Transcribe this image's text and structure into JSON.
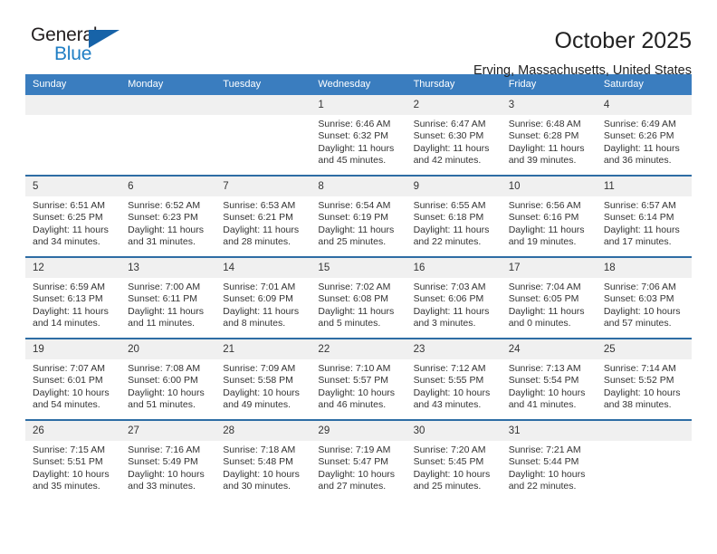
{
  "logo": {
    "word_one": "General",
    "word_two": "Blue",
    "triangle_color": "#1763a8",
    "blue_text_color": "#1f7ec4"
  },
  "header": {
    "title": "October 2025",
    "subtitle": "Erving, Massachusetts, United States"
  },
  "theme": {
    "header_row_background": "#3a7dbf",
    "week_separator": "#2e6da4",
    "date_band_background": "#f0f0f0",
    "text_color": "#333333"
  },
  "calendar": {
    "day_names": [
      "Sunday",
      "Monday",
      "Tuesday",
      "Wednesday",
      "Thursday",
      "Friday",
      "Saturday"
    ],
    "labels": {
      "sunrise": "Sunrise:",
      "sunset": "Sunset:",
      "daylight": "Daylight:"
    },
    "weeks": [
      {
        "days": [
          {
            "date": "",
            "empty": true
          },
          {
            "date": "",
            "empty": true
          },
          {
            "date": "",
            "empty": true
          },
          {
            "date": "1",
            "sunrise": "Sunrise: 6:46 AM",
            "sunset": "Sunset: 6:32 PM",
            "daylight": "Daylight: 11 hours and 45 minutes."
          },
          {
            "date": "2",
            "sunrise": "Sunrise: 6:47 AM",
            "sunset": "Sunset: 6:30 PM",
            "daylight": "Daylight: 11 hours and 42 minutes."
          },
          {
            "date": "3",
            "sunrise": "Sunrise: 6:48 AM",
            "sunset": "Sunset: 6:28 PM",
            "daylight": "Daylight: 11 hours and 39 minutes."
          },
          {
            "date": "4",
            "sunrise": "Sunrise: 6:49 AM",
            "sunset": "Sunset: 6:26 PM",
            "daylight": "Daylight: 11 hours and 36 minutes."
          }
        ]
      },
      {
        "days": [
          {
            "date": "5",
            "sunrise": "Sunrise: 6:51 AM",
            "sunset": "Sunset: 6:25 PM",
            "daylight": "Daylight: 11 hours and 34 minutes."
          },
          {
            "date": "6",
            "sunrise": "Sunrise: 6:52 AM",
            "sunset": "Sunset: 6:23 PM",
            "daylight": "Daylight: 11 hours and 31 minutes."
          },
          {
            "date": "7",
            "sunrise": "Sunrise: 6:53 AM",
            "sunset": "Sunset: 6:21 PM",
            "daylight": "Daylight: 11 hours and 28 minutes."
          },
          {
            "date": "8",
            "sunrise": "Sunrise: 6:54 AM",
            "sunset": "Sunset: 6:19 PM",
            "daylight": "Daylight: 11 hours and 25 minutes."
          },
          {
            "date": "9",
            "sunrise": "Sunrise: 6:55 AM",
            "sunset": "Sunset: 6:18 PM",
            "daylight": "Daylight: 11 hours and 22 minutes."
          },
          {
            "date": "10",
            "sunrise": "Sunrise: 6:56 AM",
            "sunset": "Sunset: 6:16 PM",
            "daylight": "Daylight: 11 hours and 19 minutes."
          },
          {
            "date": "11",
            "sunrise": "Sunrise: 6:57 AM",
            "sunset": "Sunset: 6:14 PM",
            "daylight": "Daylight: 11 hours and 17 minutes."
          }
        ]
      },
      {
        "days": [
          {
            "date": "12",
            "sunrise": "Sunrise: 6:59 AM",
            "sunset": "Sunset: 6:13 PM",
            "daylight": "Daylight: 11 hours and 14 minutes."
          },
          {
            "date": "13",
            "sunrise": "Sunrise: 7:00 AM",
            "sunset": "Sunset: 6:11 PM",
            "daylight": "Daylight: 11 hours and 11 minutes."
          },
          {
            "date": "14",
            "sunrise": "Sunrise: 7:01 AM",
            "sunset": "Sunset: 6:09 PM",
            "daylight": "Daylight: 11 hours and 8 minutes."
          },
          {
            "date": "15",
            "sunrise": "Sunrise: 7:02 AM",
            "sunset": "Sunset: 6:08 PM",
            "daylight": "Daylight: 11 hours and 5 minutes."
          },
          {
            "date": "16",
            "sunrise": "Sunrise: 7:03 AM",
            "sunset": "Sunset: 6:06 PM",
            "daylight": "Daylight: 11 hours and 3 minutes."
          },
          {
            "date": "17",
            "sunrise": "Sunrise: 7:04 AM",
            "sunset": "Sunset: 6:05 PM",
            "daylight": "Daylight: 11 hours and 0 minutes."
          },
          {
            "date": "18",
            "sunrise": "Sunrise: 7:06 AM",
            "sunset": "Sunset: 6:03 PM",
            "daylight": "Daylight: 10 hours and 57 minutes."
          }
        ]
      },
      {
        "days": [
          {
            "date": "19",
            "sunrise": "Sunrise: 7:07 AM",
            "sunset": "Sunset: 6:01 PM",
            "daylight": "Daylight: 10 hours and 54 minutes."
          },
          {
            "date": "20",
            "sunrise": "Sunrise: 7:08 AM",
            "sunset": "Sunset: 6:00 PM",
            "daylight": "Daylight: 10 hours and 51 minutes."
          },
          {
            "date": "21",
            "sunrise": "Sunrise: 7:09 AM",
            "sunset": "Sunset: 5:58 PM",
            "daylight": "Daylight: 10 hours and 49 minutes."
          },
          {
            "date": "22",
            "sunrise": "Sunrise: 7:10 AM",
            "sunset": "Sunset: 5:57 PM",
            "daylight": "Daylight: 10 hours and 46 minutes."
          },
          {
            "date": "23",
            "sunrise": "Sunrise: 7:12 AM",
            "sunset": "Sunset: 5:55 PM",
            "daylight": "Daylight: 10 hours and 43 minutes."
          },
          {
            "date": "24",
            "sunrise": "Sunrise: 7:13 AM",
            "sunset": "Sunset: 5:54 PM",
            "daylight": "Daylight: 10 hours and 41 minutes."
          },
          {
            "date": "25",
            "sunrise": "Sunrise: 7:14 AM",
            "sunset": "Sunset: 5:52 PM",
            "daylight": "Daylight: 10 hours and 38 minutes."
          }
        ]
      },
      {
        "days": [
          {
            "date": "26",
            "sunrise": "Sunrise: 7:15 AM",
            "sunset": "Sunset: 5:51 PM",
            "daylight": "Daylight: 10 hours and 35 minutes."
          },
          {
            "date": "27",
            "sunrise": "Sunrise: 7:16 AM",
            "sunset": "Sunset: 5:49 PM",
            "daylight": "Daylight: 10 hours and 33 minutes."
          },
          {
            "date": "28",
            "sunrise": "Sunrise: 7:18 AM",
            "sunset": "Sunset: 5:48 PM",
            "daylight": "Daylight: 10 hours and 30 minutes."
          },
          {
            "date": "29",
            "sunrise": "Sunrise: 7:19 AM",
            "sunset": "Sunset: 5:47 PM",
            "daylight": "Daylight: 10 hours and 27 minutes."
          },
          {
            "date": "30",
            "sunrise": "Sunrise: 7:20 AM",
            "sunset": "Sunset: 5:45 PM",
            "daylight": "Daylight: 10 hours and 25 minutes."
          },
          {
            "date": "31",
            "sunrise": "Sunrise: 7:21 AM",
            "sunset": "Sunset: 5:44 PM",
            "daylight": "Daylight: 10 hours and 22 minutes."
          },
          {
            "date": "",
            "empty": true
          }
        ]
      }
    ]
  }
}
